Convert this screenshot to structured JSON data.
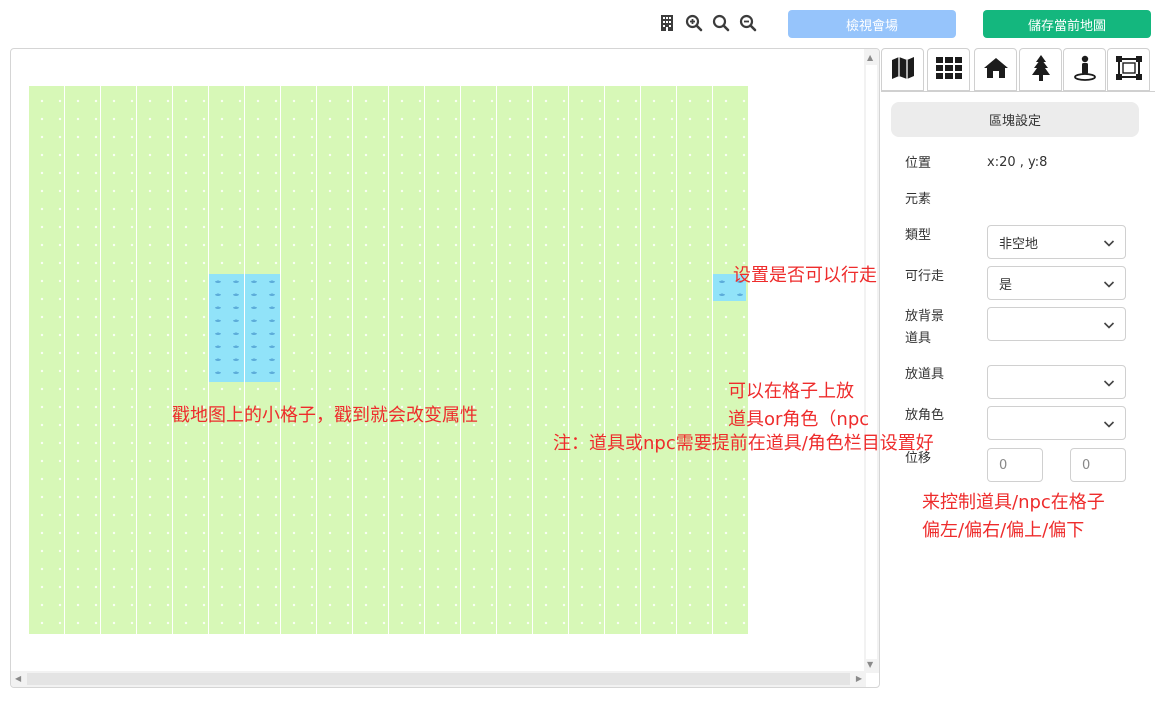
{
  "toolbar": {
    "icons": [
      "building-icon",
      "zoom-in-icon",
      "search-icon",
      "zoom-out-icon"
    ],
    "view_venue_label": "檢視會場",
    "save_map_label": "儲存當前地圖",
    "view_color": "#96c4fb",
    "save_color": "#14b77e"
  },
  "map": {
    "columns": 20,
    "tile_color": "#d7f8b7",
    "water_color": "#91e3f9"
  },
  "tabs": [
    "map-icon",
    "grid-icon",
    "home-icon",
    "tree-icon",
    "person-pin-icon",
    "select-frame-icon"
  ],
  "sidebar": {
    "section_title": "區塊設定",
    "position_label": "位置",
    "position_value": "x:20 , y:8",
    "element_label": "元素",
    "type_label": "類型",
    "type_value": "非空地",
    "walkable_label": "可行走",
    "walkable_value": "是",
    "bg_item_label_1": "放背景",
    "bg_item_label_2": "道具",
    "bg_item_value": "",
    "item_label": "放道具",
    "item_value": "",
    "character_label": "放角色",
    "character_value": "",
    "offset_label": "位移",
    "offset_x_placeholder": "0",
    "offset_y_placeholder": "0"
  },
  "annotations": {
    "walkable_note": "设置是否可以行走",
    "grid_note": "戳地图上的小格子，戳到就会改变属性",
    "place_line1": "可以在格子上放",
    "place_line2": "道具or角色（npc",
    "prereq_note": "注：道具或npc需要提前在道具/角色栏目设置好",
    "offset_line1": "来控制道具/npc在格子",
    "offset_line2": "偏左/偏右/偏上/偏下",
    "annotation_color": "#ee2c2c"
  }
}
